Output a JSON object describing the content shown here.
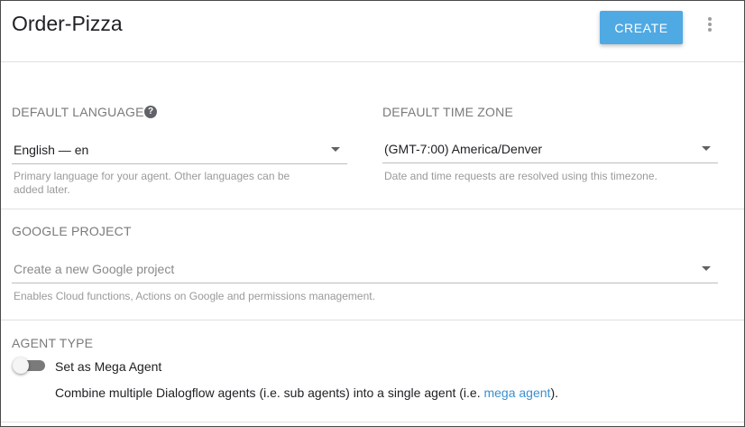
{
  "header": {
    "agent_name": "Order-Pizza",
    "create_label": "CREATE"
  },
  "language": {
    "label": "DEFAULT LANGUAGE",
    "help_glyph": "?",
    "value": "English — en",
    "hint_line1": "Primary language for your agent. Other languages can be",
    "hint_line2": "added later."
  },
  "timezone": {
    "label": "DEFAULT TIME ZONE",
    "value": "(GMT-7:00) America/Denver",
    "hint": "Date and time requests are resolved using this timezone."
  },
  "google_project": {
    "label": "GOOGLE PROJECT",
    "placeholder": "Create a new Google project",
    "hint": "Enables Cloud functions, Actions on Google and permissions management."
  },
  "agent_type": {
    "label": "AGENT TYPE",
    "toggle_label": "Set as Mega Agent",
    "toggle_on": false,
    "description_before": "Combine multiple Dialogflow agents (i.e. sub agents) into a single agent (i.e. ",
    "description_link": "mega agent",
    "description_after": ")."
  },
  "colors": {
    "accent": "#4fa9e3",
    "link": "#3a8fd0",
    "label": "#7a7a7a",
    "hint": "#9a9a9a"
  }
}
